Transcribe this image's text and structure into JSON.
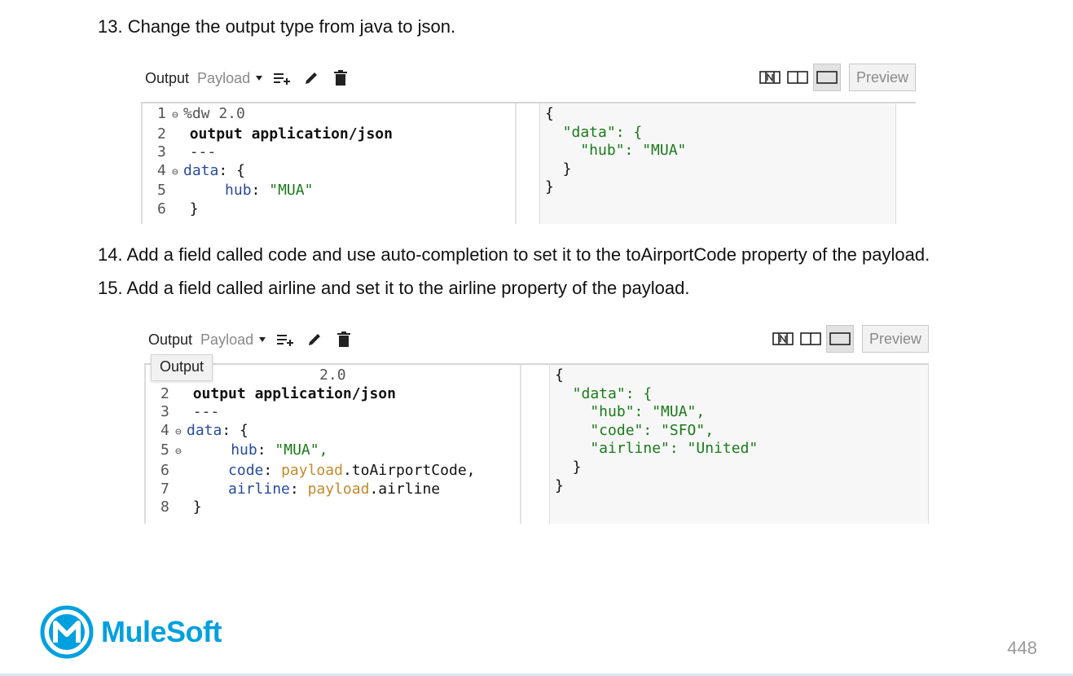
{
  "steps": {
    "s13": "13. Change the output type from java to json.",
    "s14": "14. Add a field called code and use auto-completion to set it to the toAirportCode property of the payload.",
    "s15": "15. Add a field called airline and set it to the airline property of the payload."
  },
  "panel1": {
    "toolbar": {
      "output_label": "Output",
      "payload_label": "Payload",
      "preview_label": "Preview"
    },
    "code": {
      "l1": {
        "num": "1",
        "text": "%dw 2.0"
      },
      "l2": {
        "num": "2",
        "kw": "output",
        "text": "application/json"
      },
      "l3": {
        "num": "3",
        "text": "---"
      },
      "l4": {
        "num": "4",
        "key": "data",
        "text": ": {"
      },
      "l5": {
        "num": "5",
        "key": "hub",
        "str": "\"MUA\""
      },
      "l6": {
        "num": "6",
        "text": "}"
      }
    },
    "preview": [
      "{",
      "  \"data\": {",
      "    \"hub\": \"MUA\"",
      "  }",
      "}"
    ]
  },
  "panel2": {
    "toolbar": {
      "output_label": "Output",
      "payload_label": "Payload",
      "preview_label": "Preview"
    },
    "tooltip": "Output",
    "code": {
      "l1": {
        "text": "2.0"
      },
      "l2": {
        "num": "2",
        "kw": "output",
        "text": "application/json"
      },
      "l3": {
        "num": "3",
        "text": "---"
      },
      "l4": {
        "num": "4",
        "key": "data",
        "text": ": {"
      },
      "l5": {
        "num": "5",
        "key": "hub",
        "str": "\"MUA\","
      },
      "l6": {
        "num": "6",
        "key": "code",
        "pl": "payload",
        "rest": ".toAirportCode,"
      },
      "l7": {
        "num": "7",
        "key": "airline",
        "pl": "payload",
        "rest": ".airline"
      },
      "l8": {
        "num": "8",
        "text": "}"
      }
    },
    "preview": [
      "{",
      "  \"data\": {",
      "    \"hub\": \"MUA\",",
      "    \"code\": \"SFO\",",
      "    \"airline\": \"United\"",
      "  }",
      "}"
    ]
  },
  "footer": {
    "brand": "MuleSoft",
    "page_number": "448",
    "brand_color": "#00a0df"
  }
}
